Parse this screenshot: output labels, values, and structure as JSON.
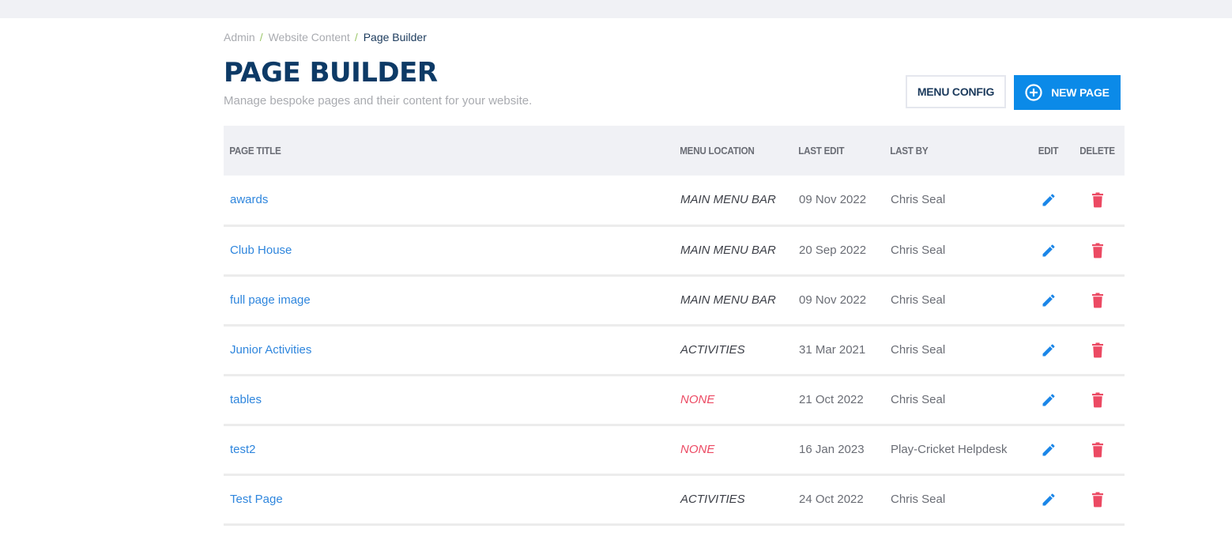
{
  "breadcrumb": {
    "items": [
      "Admin",
      "Website Content"
    ],
    "separator": "/",
    "current": "Page Builder"
  },
  "header": {
    "title": "PAGE BUILDER",
    "subtitle": "Manage bespoke pages and their content for your website.",
    "menu_config_label": "MENU CONFIG",
    "new_page_label": "NEW PAGE",
    "new_page_icon": "plus-circle-icon"
  },
  "colors": {
    "primary": "#0b8ae8",
    "title": "#0d3a66",
    "link": "#2f86dd",
    "danger": "#ec4a63"
  },
  "table": {
    "columns": {
      "page_title": "PAGE TITLE",
      "menu_location": "MENU LOCATION",
      "last_edit": "LAST EDIT",
      "last_by": "LAST BY",
      "edit": "EDIT",
      "delete": "DELETE"
    },
    "rows": [
      {
        "title": "awards",
        "menu_location": "MAIN MENU BAR",
        "last_edit": "09 Nov 2022",
        "last_by": "Chris Seal"
      },
      {
        "title": "Club House",
        "menu_location": "MAIN MENU BAR",
        "last_edit": "20 Sep 2022",
        "last_by": "Chris Seal"
      },
      {
        "title": "full page image",
        "menu_location": "MAIN MENU BAR",
        "last_edit": "09 Nov 2022",
        "last_by": "Chris Seal"
      },
      {
        "title": "Junior Activities",
        "menu_location": "ACTIVITIES",
        "last_edit": "31 Mar 2021",
        "last_by": "Chris Seal"
      },
      {
        "title": "tables",
        "menu_location": "NONE",
        "last_edit": "21 Oct 2022",
        "last_by": "Chris Seal"
      },
      {
        "title": "test2",
        "menu_location": "NONE",
        "last_edit": "16 Jan 2023",
        "last_by": "Play-Cricket Helpdesk"
      },
      {
        "title": "Test Page",
        "menu_location": "ACTIVITIES",
        "last_edit": "24 Oct 2022",
        "last_by": "Chris Seal"
      }
    ]
  }
}
